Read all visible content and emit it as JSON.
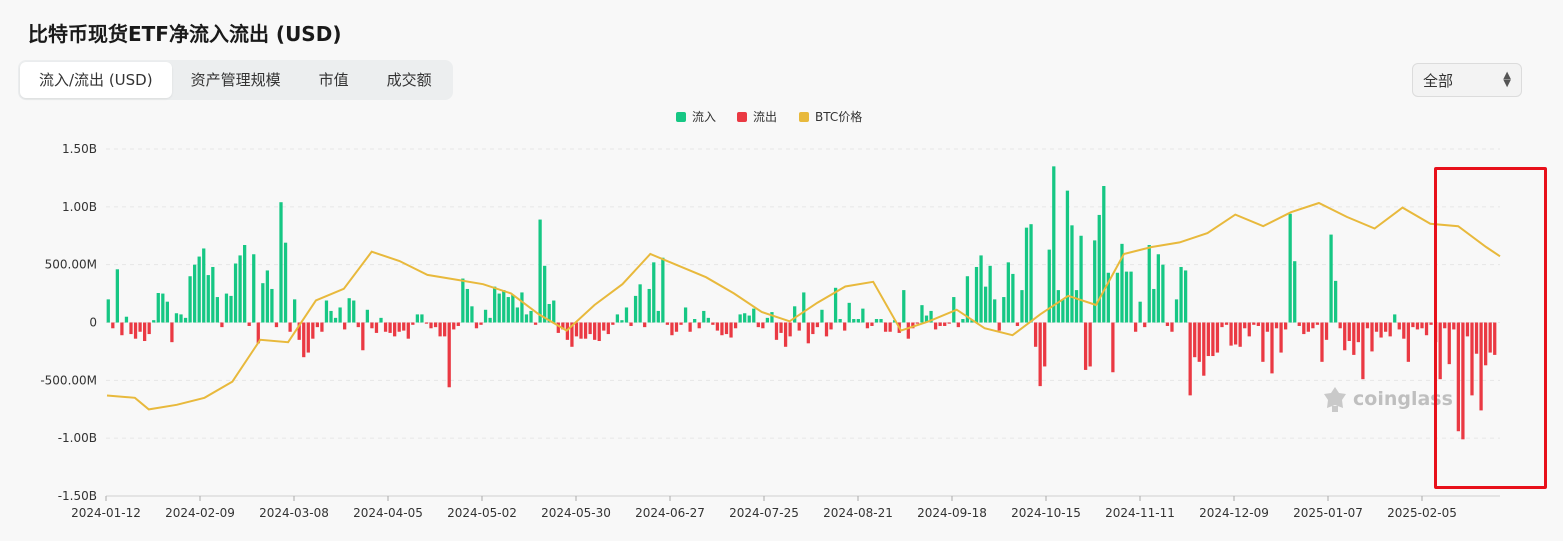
{
  "title": "比特币现货ETF净流入流出 (USD)",
  "tabs": [
    {
      "label": "流入/流出 (USD)",
      "active": true
    },
    {
      "label": "资产管理规模",
      "active": false
    },
    {
      "label": "市值",
      "active": false
    },
    {
      "label": "成交额",
      "active": false
    }
  ],
  "range_select": {
    "value": "全部"
  },
  "watermark": "coinglass",
  "colors": {
    "inflow": "#16c784",
    "outflow": "#ea3943",
    "price": "#e8b93c",
    "highlight": "#e8101a"
  },
  "chart_data": {
    "type": "bar",
    "legend": [
      {
        "name": "流入",
        "color": "#16c784"
      },
      {
        "name": "流出",
        "color": "#ea3943"
      },
      {
        "name": "BTC价格",
        "color": "#e8b93c"
      }
    ],
    "legend_position": "top-center",
    "y_ticks": [
      "1.50B",
      "1.00B",
      "500.00M",
      "0",
      "-500.00M",
      "-1.00B",
      "-1.50B"
    ],
    "ylim_millions": [
      -1500,
      1500
    ],
    "x_ticks": [
      "2024-01-12",
      "2024-02-09",
      "2024-03-08",
      "2024-04-05",
      "2024-05-02",
      "2024-05-30",
      "2024-06-27",
      "2024-07-25",
      "2024-08-21",
      "2024-09-18",
      "2024-10-15",
      "2024-11-11",
      "2024-12-09",
      "2025-01-07",
      "2025-02-05"
    ],
    "grid": true,
    "net_flow_millions": [
      200,
      -50,
      460,
      -110,
      50,
      -100,
      -140,
      -80,
      -160,
      -100,
      20,
      255,
      250,
      180,
      -170,
      80,
      70,
      40,
      400,
      500,
      570,
      640,
      410,
      480,
      220,
      -40,
      250,
      230,
      510,
      580,
      670,
      -30,
      590,
      -180,
      340,
      450,
      290,
      -40,
      1040,
      690,
      -80,
      200,
      -150,
      -300,
      -260,
      -140,
      -40,
      -80,
      190,
      100,
      40,
      130,
      -60,
      210,
      190,
      -40,
      -240,
      110,
      -50,
      -90,
      40,
      -80,
      -90,
      -120,
      -80,
      -70,
      -140,
      -20,
      70,
      70,
      -10,
      -50,
      -40,
      -120,
      -120,
      -560,
      -60,
      -30,
      380,
      290,
      140,
      -50,
      -20,
      110,
      40,
      310,
      250,
      280,
      220,
      240,
      130,
      260,
      70,
      100,
      -20,
      890,
      490,
      160,
      190,
      -90,
      -60,
      -150,
      -210,
      -120,
      -140,
      -140,
      -100,
      -150,
      -160,
      -70,
      -100,
      -20,
      70,
      20,
      130,
      -30,
      230,
      330,
      -40,
      290,
      520,
      100,
      560,
      -20,
      -110,
      -80,
      -20,
      130,
      -80,
      30,
      -50,
      100,
      40,
      -20,
      -70,
      -110,
      -100,
      -130,
      -50,
      70,
      80,
      60,
      120,
      -40,
      -50,
      40,
      90,
      -150,
      -90,
      -210,
      -120,
      140,
      -70,
      260,
      -180,
      -100,
      -40,
      110,
      -120,
      -60,
      300,
      30,
      -70,
      170,
      30,
      30,
      120,
      -50,
      -30,
      30,
      30,
      -80,
      -80,
      20,
      -90,
      280,
      -140,
      -50,
      -10,
      150,
      60,
      100,
      -60,
      -30,
      -30,
      -10,
      220,
      -40,
      30,
      400,
      20,
      480,
      580,
      310,
      490,
      200,
      -70,
      220,
      520,
      420,
      -30,
      280,
      820,
      850,
      -210,
      -550,
      -380,
      630,
      1350,
      280,
      200,
      1140,
      840,
      280,
      750,
      -410,
      -380,
      710,
      930,
      1180,
      430,
      -430,
      430,
      680,
      440,
      440,
      -80,
      180,
      -40,
      670,
      290,
      590,
      500,
      -30,
      -80,
      200,
      480,
      450,
      -630,
      -300,
      -340,
      -460,
      -290,
      -290,
      -260,
      -40,
      -20,
      -200,
      -190,
      -210,
      -50,
      -120,
      -20,
      -30,
      -340,
      -80,
      -440,
      -50,
      -260,
      -60,
      940,
      530,
      -30,
      -100,
      -80,
      -50,
      -20,
      -340,
      -150,
      760,
      360,
      -50,
      -240,
      -160,
      -280,
      -170,
      -490,
      -50,
      -250,
      -80,
      -130,
      -80,
      -120,
      70,
      -60,
      -140,
      -340,
      -40,
      -60,
      -50,
      -110,
      -20,
      -170,
      -490,
      -50,
      -360,
      -60,
      -940,
      -1010,
      -120,
      -630,
      -270,
      -760,
      -370,
      -260,
      -280
    ]
  }
}
